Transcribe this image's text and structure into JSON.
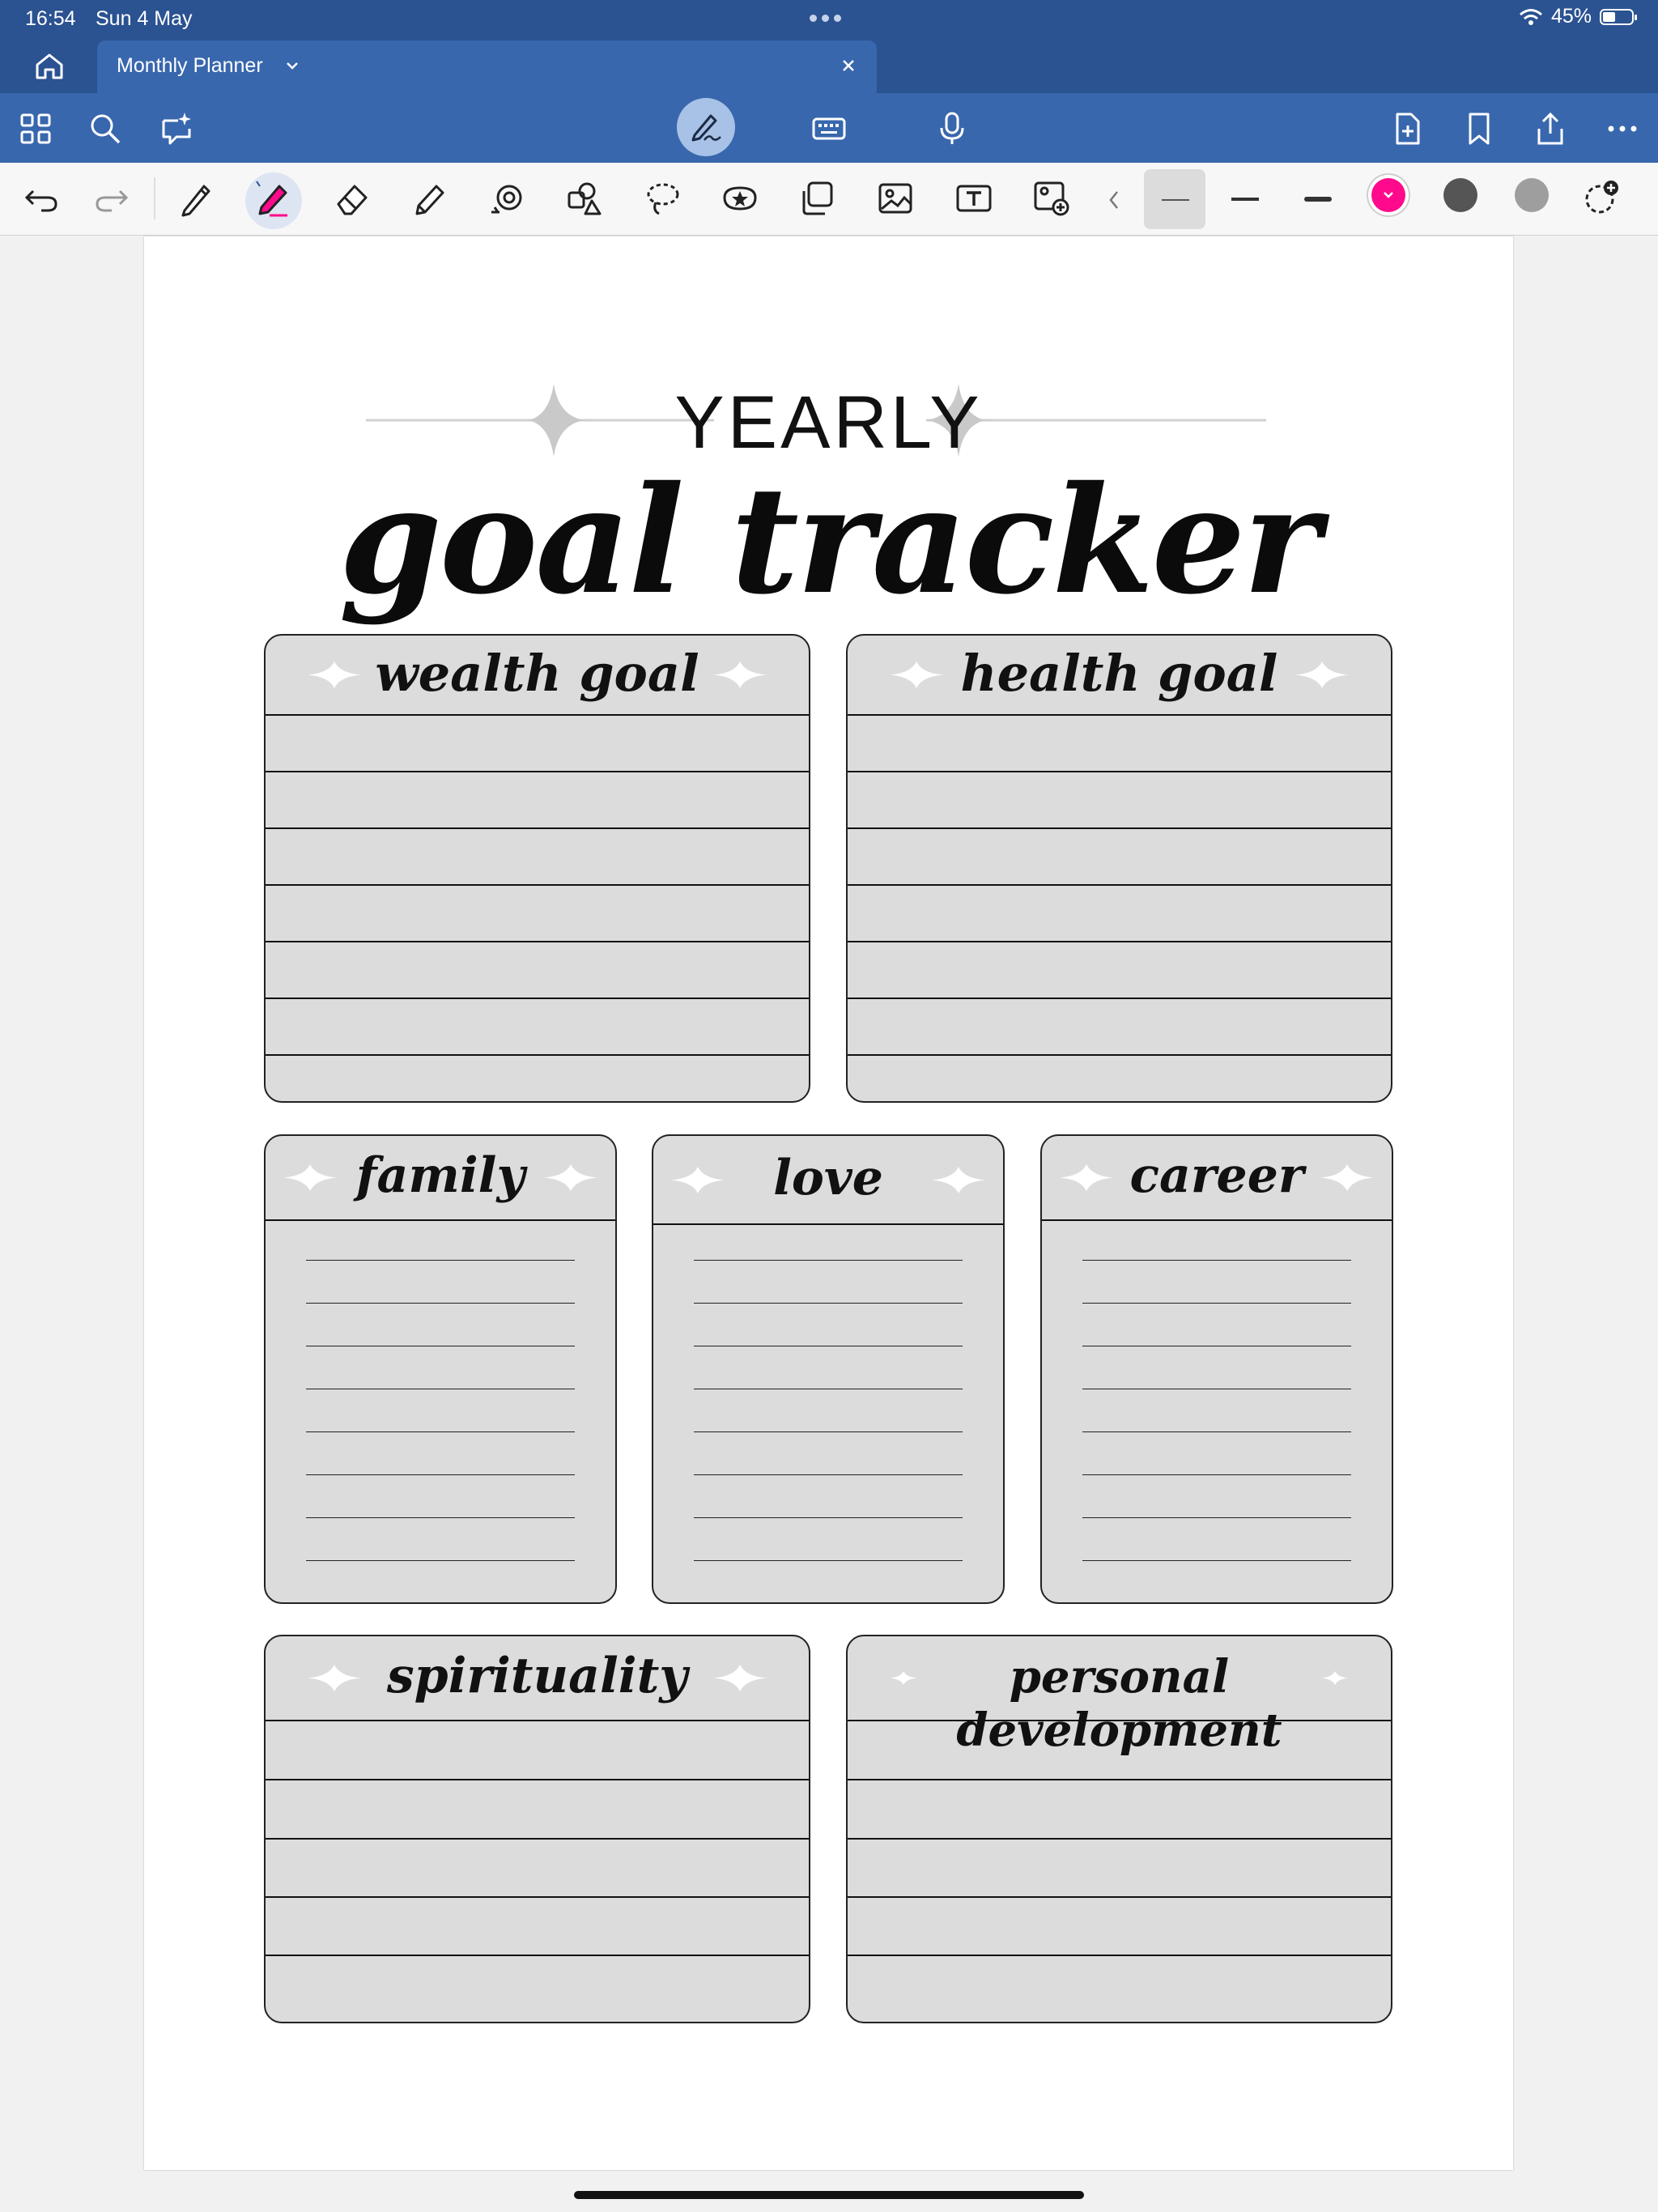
{
  "status": {
    "time": "16:54",
    "date": "Sun 4 May",
    "battery": "45%",
    "battery_level": 0.45
  },
  "tab": {
    "title": "Monthly Planner"
  },
  "toolbar": {
    "left_icons": [
      "thumbnails-icon",
      "search-icon",
      "ai-assist-icon"
    ],
    "center_icons": [
      "handwriting-pen-icon",
      "keyboard-icon",
      "microphone-icon"
    ],
    "right_icons": [
      "add-page-icon",
      "bookmark-icon",
      "share-icon",
      "more-icon"
    ]
  },
  "drawbar": {
    "tools": [
      "undo-icon",
      "redo-icon",
      "pen-icon",
      "highlight-pen-icon",
      "eraser-icon",
      "highlighter-icon",
      "shape-tool-icon",
      "shapes-icon",
      "lasso-icon",
      "sticker-icon",
      "elements-icon",
      "image-icon",
      "text-box-icon",
      "camera-image-icon"
    ],
    "selected_color": "#ff0a8c",
    "colors": [
      "#ff0a8c",
      "#555555",
      "#9e9e9e"
    ]
  },
  "page": {
    "heading": "YEARLY",
    "title": "goal tracker",
    "sections": [
      {
        "label": "wealth goal"
      },
      {
        "label": "health goal"
      },
      {
        "label": "family"
      },
      {
        "label": "love"
      },
      {
        "label": "career"
      },
      {
        "label": "spirituality"
      },
      {
        "label": "personal development"
      }
    ]
  }
}
